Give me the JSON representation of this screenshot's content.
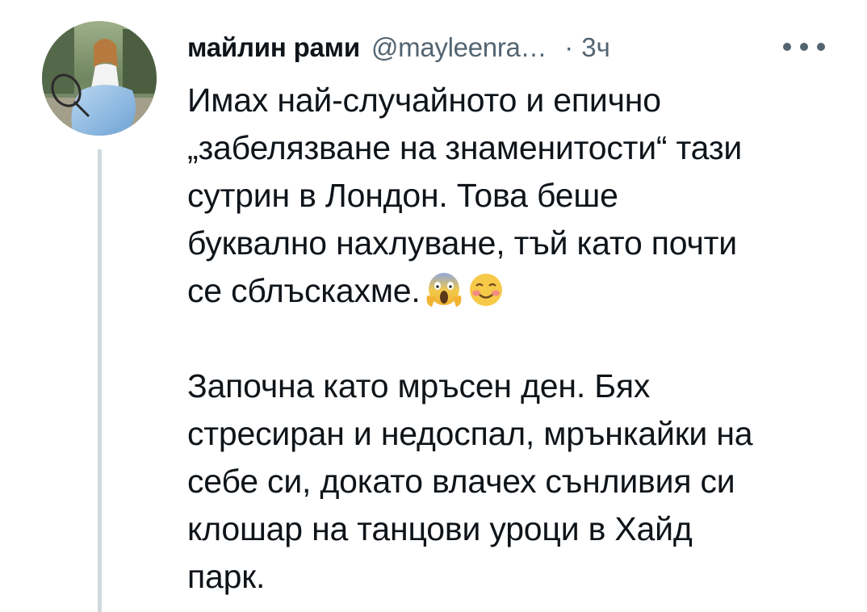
{
  "tweet": {
    "display_name": "майлин рами",
    "handle": "@mayleenra…",
    "separator": "·",
    "time": "3ч",
    "more_icon": "more-horizontal-icon",
    "paragraph1": {
      "lines": [
        "Имах най-случайното и епично",
        "„забелязване на знаменитости“ тази",
        "сутрин в Лондон. Това беше",
        "буквално нахлуване, тъй като почти",
        "се сблъскахме."
      ],
      "emojis": [
        "face-screaming-in-fear-emoji",
        "smiling-face-emoji"
      ]
    },
    "paragraph2": {
      "lines": [
        "Започна като мръсен ден. Бях",
        "стресиран и недоспал, мрънкайки на",
        "себе си, докато влачех сънливия си",
        "клошар на танцови уроци в Хайд",
        "парк."
      ]
    }
  },
  "colors": {
    "text_primary": "#0f1419",
    "text_secondary": "#536471",
    "thread_line": "#cfd9de",
    "background": "#ffffff"
  }
}
